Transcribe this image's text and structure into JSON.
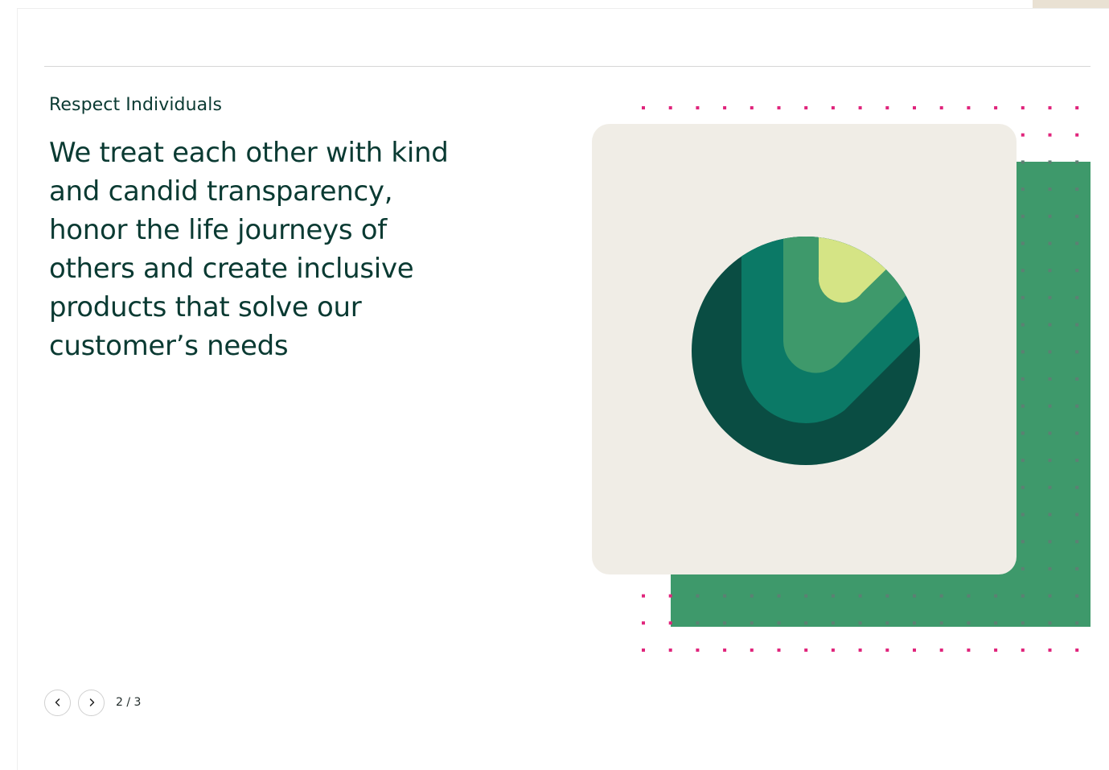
{
  "slide": {
    "eyebrow": "Respect Individuals",
    "headline": "We treat each other with kind and candid transparency, honor the life journeys of others and create inclusive products that solve our customer’s needs",
    "counter": "2 / 3"
  },
  "pager": {
    "prev_icon": "chevron-left-icon",
    "next_icon": "chevron-right-icon"
  },
  "colors": {
    "text": "#0a3a32",
    "card": "#f0ede6",
    "green_block": "#3e996b",
    "dots_pink": "#e0257c",
    "dots_grey": "#5d7f73",
    "logo_dark": "#0a4d43",
    "logo_teal": "#0b7966",
    "logo_mid": "#3e996b",
    "logo_lime": "#d5e485"
  }
}
